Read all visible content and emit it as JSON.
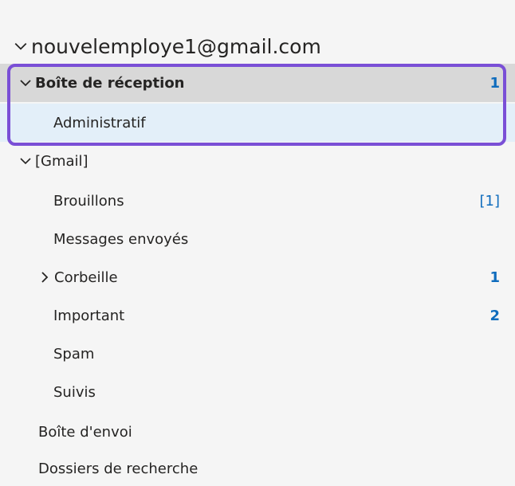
{
  "account": {
    "email": "nouvelemploye1@gmail.com"
  },
  "folders": [
    {
      "label": "Boîte de réception",
      "count": "1",
      "expanded": true,
      "selected": true
    },
    {
      "label": "Administratif",
      "count": ""
    },
    {
      "label": "[Gmail]",
      "count": "",
      "expanded": true
    },
    {
      "label": "Brouillons",
      "count": "[1]"
    },
    {
      "label": "Messages envoyés",
      "count": ""
    },
    {
      "label": "Corbeille",
      "count": "1",
      "expanded": false
    },
    {
      "label": "Important",
      "count": "2"
    },
    {
      "label": "Spam",
      "count": ""
    },
    {
      "label": "Suivis",
      "count": ""
    },
    {
      "label": "Boîte d'envoi",
      "count": ""
    },
    {
      "label": "Dossiers de recherche",
      "count": ""
    }
  ],
  "colors": {
    "accent_count": "#0f6cbd",
    "highlight_frame": "#7a4fd6",
    "selected_row": "#d8d8d8",
    "sub_selected_row": "#e3eff9"
  },
  "icons": {
    "expanded": "chevron-down-icon",
    "collapsed": "chevron-right-icon"
  }
}
